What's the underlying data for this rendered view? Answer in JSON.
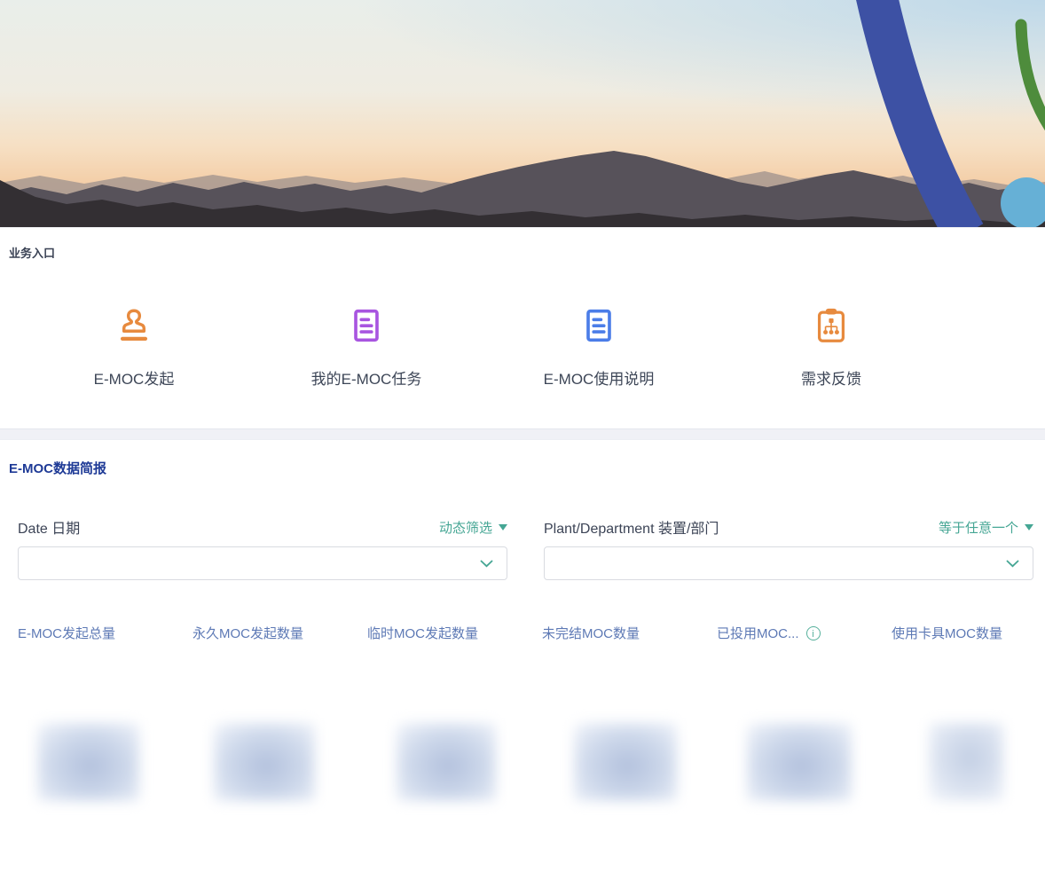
{
  "hero": {
    "description": "mountain-sunset-photo-banner",
    "decor_colors": {
      "blue_arc": "#3d51a4",
      "green_arc": "#4e8c3c",
      "blue_circle": "#66b0d6"
    }
  },
  "business_entry": {
    "title": "业务入口",
    "items": [
      {
        "label": "E-MOC发起",
        "icon": "stamp-icon",
        "icon_color": "#e78a3e"
      },
      {
        "label": "我的E-MOC任务",
        "icon": "document-lines-icon",
        "icon_color": "#a855e0"
      },
      {
        "label": "E-MOC使用说明",
        "icon": "document-lines-icon",
        "icon_color": "#4b7de8"
      },
      {
        "label": "需求反馈",
        "icon": "clipboard-orgchart-icon",
        "icon_color": "#e78a3e"
      }
    ]
  },
  "data_brief": {
    "title": "E-MOC数据简报",
    "filters": [
      {
        "label": "Date 日期",
        "mode_label": "动态筛选",
        "value": "",
        "placeholder": ""
      },
      {
        "label": "Plant/Department 装置/部门",
        "mode_label": "等于任意一个",
        "value": "",
        "placeholder": ""
      }
    ],
    "stats": [
      {
        "label": "E-MOC发起总量",
        "value_redacted": true
      },
      {
        "label": "永久MOC发起数量",
        "value_redacted": true
      },
      {
        "label": "临时MOC发起数量",
        "value_redacted": true
      },
      {
        "label": "未完结MOC数量",
        "value_redacted": true
      },
      {
        "label": "已投用MOC...",
        "value_redacted": true,
        "info_icon": true
      },
      {
        "label": "使用卡具MOC数量",
        "value_redacted": true
      }
    ]
  },
  "colors": {
    "accent_teal": "#45a694",
    "section_title_navy": "#1e3a96",
    "stat_header_blue": "#5d79b5",
    "entry_orange": "#e78a3e",
    "entry_purple": "#a855e0",
    "entry_blue": "#4b7de8"
  }
}
